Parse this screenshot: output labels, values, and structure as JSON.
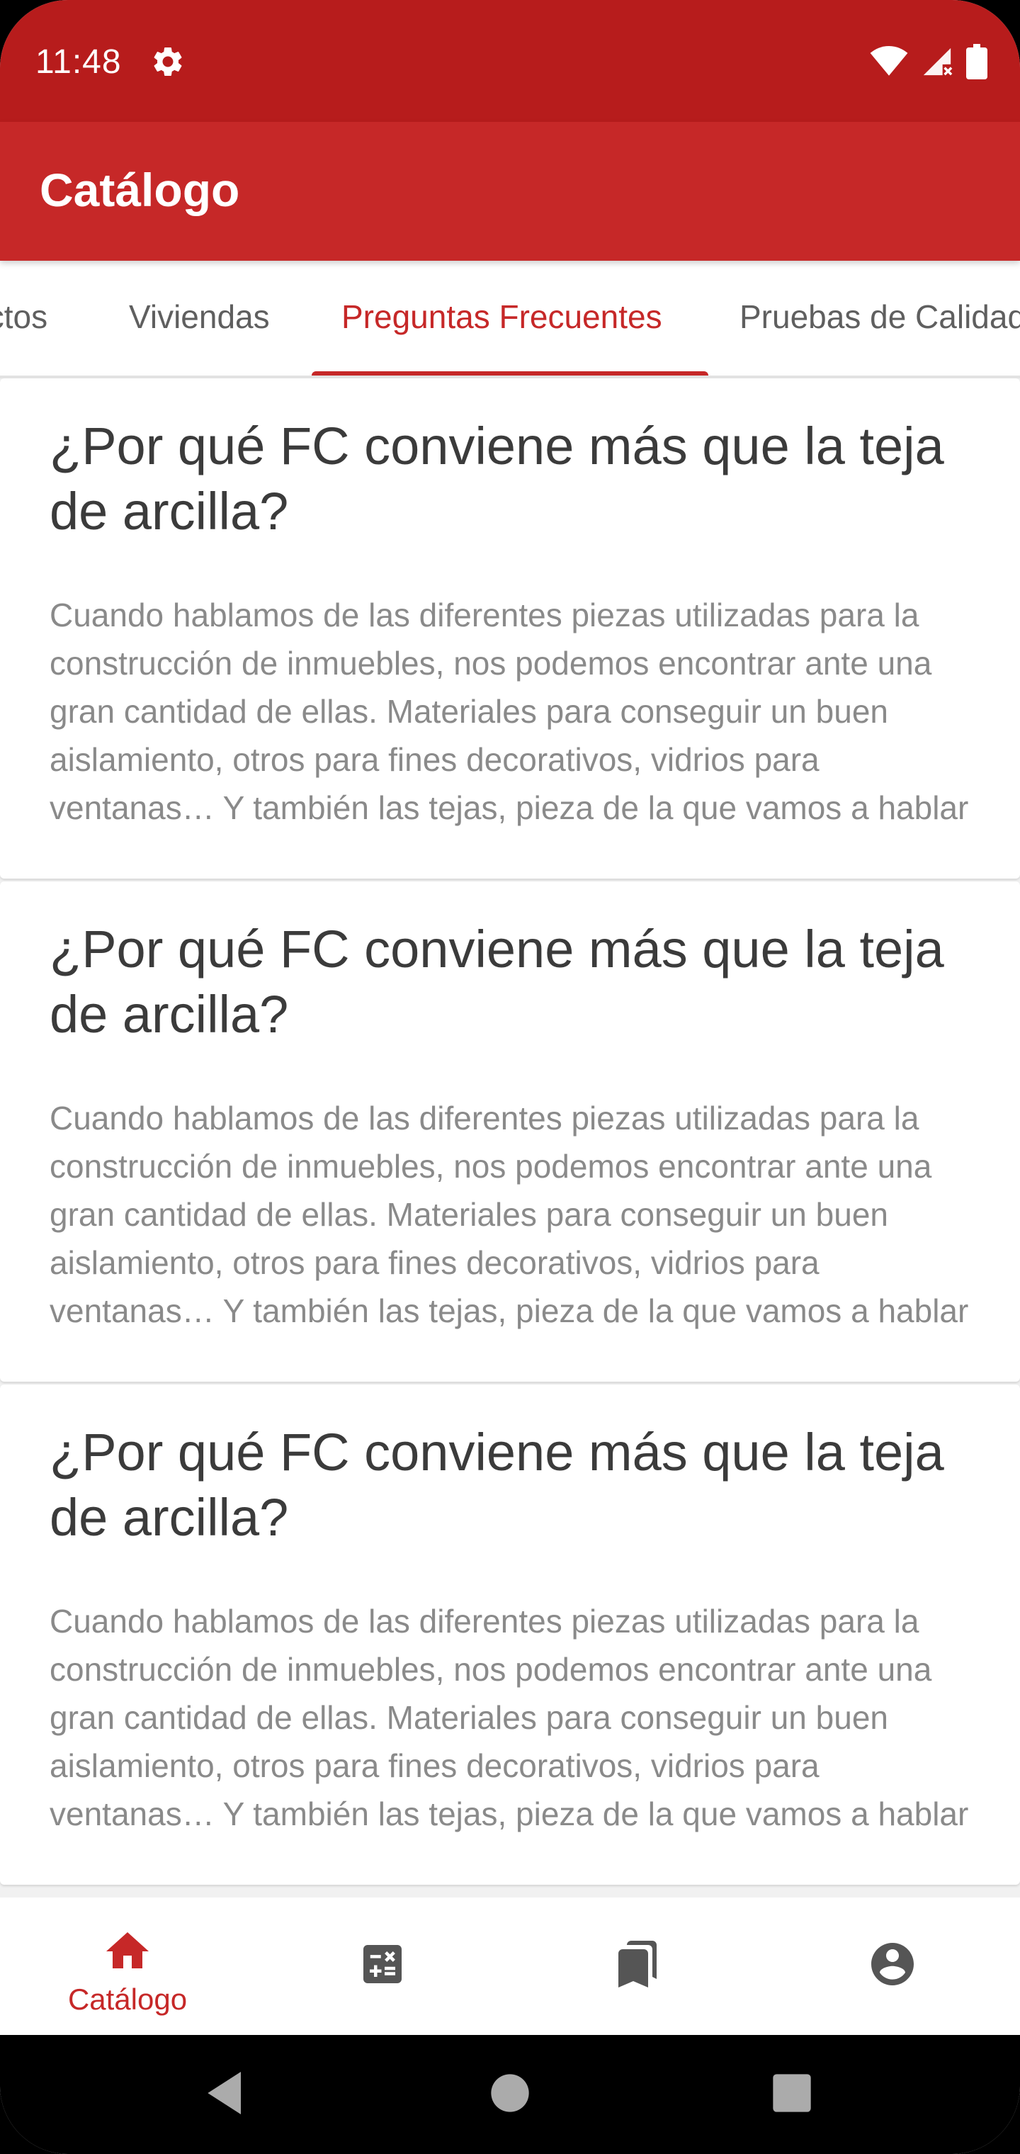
{
  "status_bar": {
    "time": "11:48",
    "icons": [
      "gear-icon",
      "wifi-icon",
      "signal-icon",
      "battery-icon"
    ]
  },
  "app_bar": {
    "title": "Catálogo"
  },
  "tabs": [
    {
      "label": "Productos",
      "active": false
    },
    {
      "label": "Viviendas",
      "active": false
    },
    {
      "label": "Preguntas Frecuentes",
      "active": true
    },
    {
      "label": "Pruebas de Calidad",
      "active": false
    }
  ],
  "faqs": [
    {
      "title": "¿Por qué FC conviene más que la teja de arcilla?",
      "body": "Cuando hablamos de las diferentes piezas utilizadas para la construcción de inmuebles, nos podemos encontrar ante una gran cantidad de ellas. Materiales para conseguir un buen aislamiento, otros para fines decorativos, vidrios para ventanas… Y también las tejas, pieza de la que vamos a hablar"
    },
    {
      "title": "¿Por qué FC conviene más que la teja de arcilla?",
      "body": "Cuando hablamos de las diferentes piezas utilizadas para la construcción de inmuebles, nos podemos encontrar ante una gran cantidad de ellas. Materiales para conseguir un buen aislamiento, otros para fines decorativos, vidrios para ventanas… Y también las tejas, pieza de la que vamos a hablar"
    },
    {
      "title": "¿Por qué FC conviene más que la teja de arcilla?",
      "body": "Cuando hablamos de las diferentes piezas utilizadas para la construcción de inmuebles, nos podemos encontrar ante una gran cantidad de ellas. Materiales para conseguir un buen aislamiento, otros para fines decorativos, vidrios para ventanas… Y también las tejas, pieza de la que vamos a hablar"
    }
  ],
  "bottom_nav": {
    "items": [
      {
        "icon": "home-icon",
        "label": "Catálogo",
        "active": true
      },
      {
        "icon": "calculator-icon",
        "label": "",
        "active": false
      },
      {
        "icon": "bookmarks-icon",
        "label": "",
        "active": false
      },
      {
        "icon": "account-icon",
        "label": "",
        "active": false
      }
    ]
  },
  "system_nav": {
    "buttons": [
      "back-icon",
      "home-circle-icon",
      "recents-icon"
    ]
  },
  "colors": {
    "status_bar": "#b71c1c",
    "primary": "#c62828",
    "tab_inactive": "#5f5f5f",
    "card_title": "#3b3b3b",
    "card_body": "#8a8a8a",
    "nav_inactive": "#555555"
  }
}
